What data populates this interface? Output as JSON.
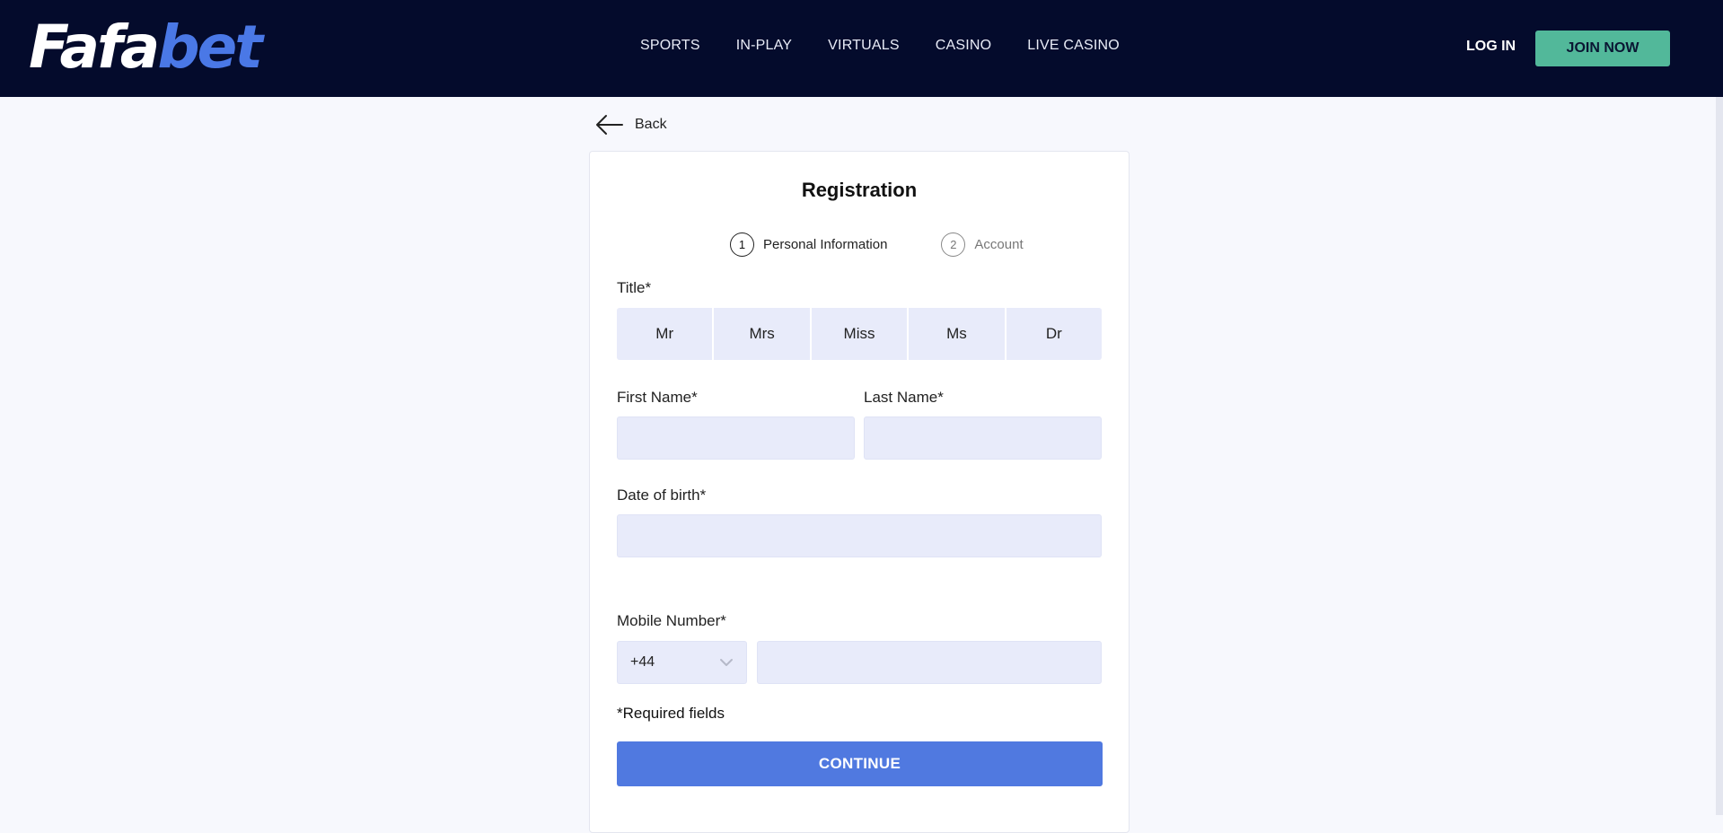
{
  "header": {
    "logo_white": "Fafa",
    "logo_blue": "bet",
    "nav": [
      "SPORTS",
      "IN-PLAY",
      "VIRTUALS",
      "CASINO",
      "LIVE CASINO"
    ],
    "login_label": "LOG IN",
    "join_label": "JOIN NOW"
  },
  "back_label": "Back",
  "form": {
    "title": "Registration",
    "steps": [
      {
        "number": "1",
        "label": "Personal Information"
      },
      {
        "number": "2",
        "label": "Account"
      }
    ],
    "title_label": "Title*",
    "title_options": [
      "Mr",
      "Mrs",
      "Miss",
      "Ms",
      "Dr"
    ],
    "first_name_label": "First Name*",
    "first_name_value": "",
    "last_name_label": "Last Name*",
    "last_name_value": "",
    "dob_label": "Date of birth*",
    "dob_value": "",
    "mobile_label": "Mobile Number*",
    "country_code": "+44",
    "mobile_value": "",
    "required_note": "*Required fields",
    "continue_label": "CONTINUE"
  },
  "colors": {
    "header_bg": "#040b2c",
    "brand_blue": "#4a78e6",
    "join_green": "#52b89a",
    "continue_blue": "#5079e0",
    "input_bg": "#e8ebfa"
  }
}
